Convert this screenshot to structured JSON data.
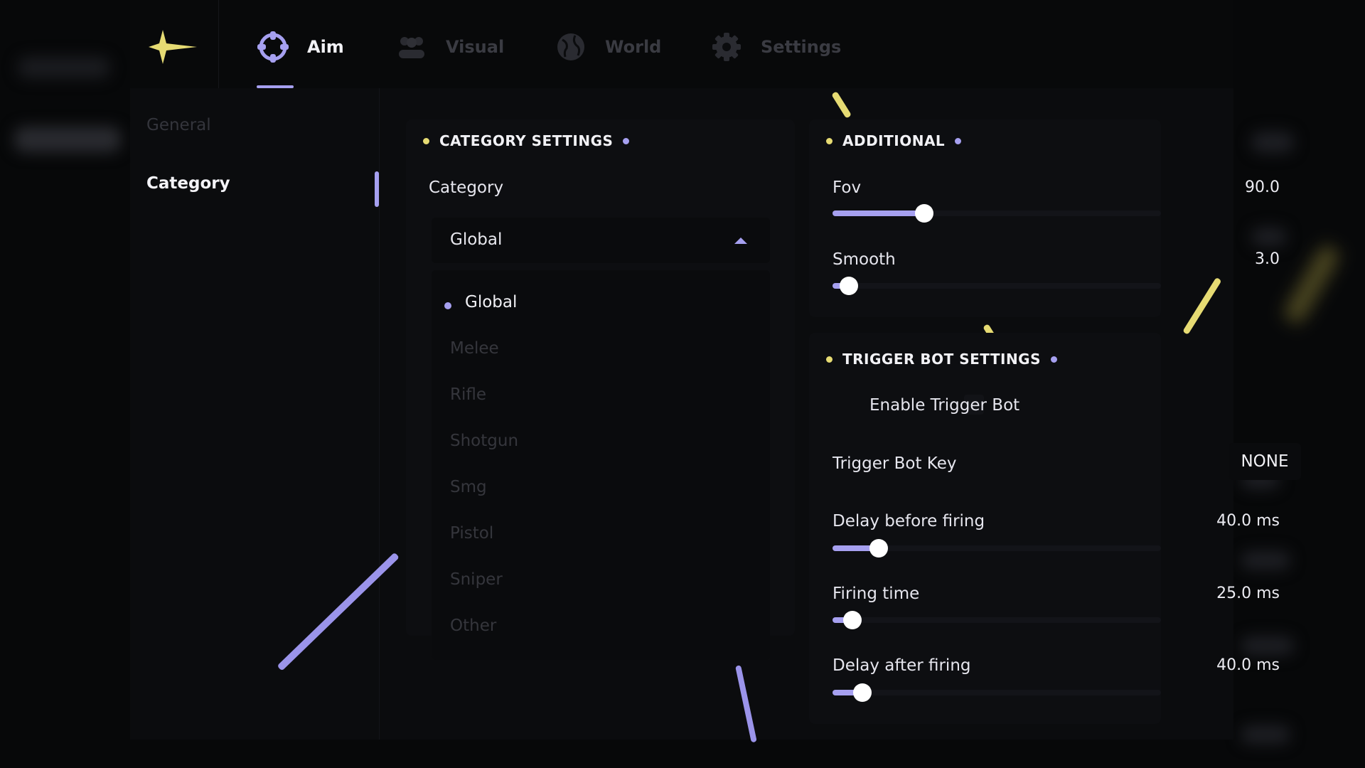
{
  "tabs": [
    {
      "label": "Aim",
      "icon": "crosshair-icon",
      "active": true
    },
    {
      "label": "Visual",
      "icon": "users-icon",
      "active": false
    },
    {
      "label": "World",
      "icon": "globe-icon",
      "active": false
    },
    {
      "label": "Settings",
      "icon": "gear-icon",
      "active": false
    }
  ],
  "sidebar": {
    "items": [
      {
        "label": "General",
        "active": false
      },
      {
        "label": "Category",
        "active": true
      }
    ]
  },
  "category_settings": {
    "title": "CATEGORY SETTINGS",
    "field_label": "Category",
    "selected": "Global",
    "options": [
      "Global",
      "Melee",
      "Rifle",
      "Shotgun",
      "Smg",
      "Pistol",
      "Sniper",
      "Other"
    ]
  },
  "additional": {
    "title": "ADDITIONAL",
    "fov": {
      "label": "Fov",
      "value": "90.0",
      "level": 0.28
    },
    "smooth": {
      "label": "Smooth",
      "value": "3.0",
      "level": 0.05
    }
  },
  "trigger_bot": {
    "title": "TRIGGER BOT SETTINGS",
    "enable_label": "Enable Trigger Bot",
    "enabled": false,
    "key_label": "Trigger Bot Key",
    "key_value": "NONE",
    "delay_before": {
      "label": "Delay before firing",
      "value": "40.0 ms",
      "level": 0.14
    },
    "firing_time": {
      "label": "Firing time",
      "value": "25.0 ms",
      "level": 0.06
    },
    "delay_after": {
      "label": "Delay after firing",
      "value": "40.0 ms",
      "level": 0.09
    }
  },
  "colors": {
    "accent": "#a6a0f0",
    "highlight": "#e6db73",
    "background": "#0b0c0e"
  }
}
